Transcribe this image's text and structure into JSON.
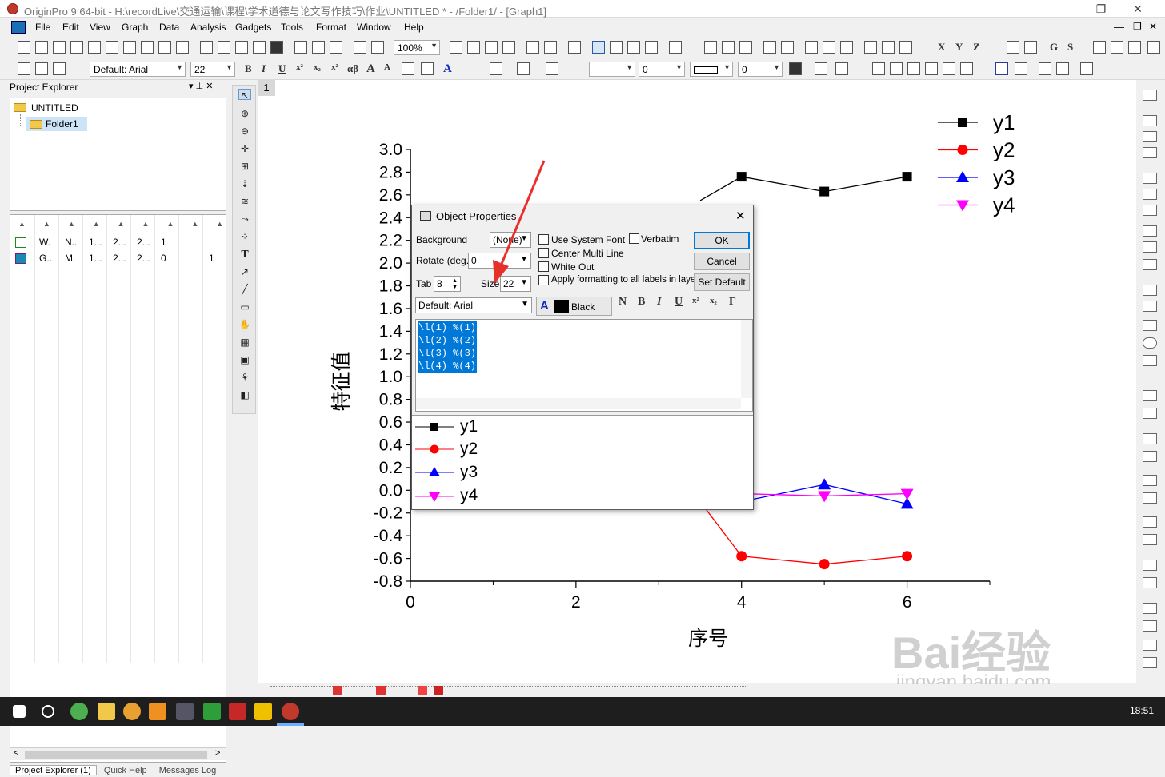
{
  "window": {
    "title": "OriginPro 9 64-bit - H:\\recordLive\\交通运输\\课程\\学术道德与论文写作技巧\\作业\\UNTITLED * - /Folder1/ - [Graph1]",
    "minimize": "—",
    "restore": "❐",
    "close": "✕"
  },
  "menu": {
    "file": "File",
    "edit": "Edit",
    "view": "View",
    "graph": "Graph",
    "data": "Data",
    "analysis": "Analysis",
    "gadgets": "Gadgets",
    "tools": "Tools",
    "format": "Format",
    "window": "Window",
    "help": "Help"
  },
  "toolbar": {
    "zoom": "100%",
    "font": "Default: Arial",
    "font_size": "22",
    "bold": "B",
    "italic": "I",
    "underline": "U",
    "superscript": "x²",
    "subscript": "x₂",
    "greek": "αβ",
    "font_larger": "A",
    "font_smaller": "A",
    "line_width": "0",
    "pattern": "0",
    "xyz": [
      "X",
      "Y",
      "Z"
    ],
    "gs": [
      "G",
      "S"
    ]
  },
  "project_explorer": {
    "title": "Project Explorer",
    "pin": "▾ ⊥ ✕",
    "root": "UNTITLED",
    "folder": "Folder1",
    "rows": [
      [
        "W.",
        "N..",
        "1...",
        "2...",
        "2...",
        "1",
        ""
      ],
      [
        "G..",
        "M.",
        "1...",
        "2...",
        "2...",
        "0",
        "1"
      ]
    ],
    "tabs": [
      "Project Explorer (1)",
      "Quick Help",
      "Messages Log"
    ]
  },
  "graph": {
    "tab": "1",
    "watermark_1": "Bai经验",
    "watermark_2": "jingyan.baidu.com"
  },
  "dialog": {
    "title": "Object Properties",
    "close": "✕",
    "background_label": "Background",
    "background_value": "(None)",
    "rotate_label": "Rotate (deg.)",
    "rotate_value": "0",
    "tab_label": "Tab",
    "tab_value": "8",
    "size_label": "Size",
    "size_value": "22",
    "font_value": "Default: Arial",
    "color_value": "Black",
    "use_system_font": "Use System Font",
    "verbatim": "Verbatim",
    "center_multi_line": "Center Multi Line",
    "white_out": "White Out",
    "apply_all": "Apply formatting to all labels in layer",
    "ok": "OK",
    "cancel": "Cancel",
    "set_default": "Set Default",
    "fmt": {
      "normal": "N",
      "bold": "B",
      "italic": "I",
      "underline": "U",
      "sup": "x²",
      "sub": "x₂",
      "greek": "Γ"
    },
    "text_lines": [
      "\\l(1) %(1)",
      "\\l(2) %(2)",
      "\\l(3) %(3)",
      "\\l(4) %(4)"
    ],
    "preview": [
      "y1",
      "y2",
      "y3",
      "y4"
    ]
  },
  "taskbar": {
    "time": "18:51"
  },
  "chart_data": {
    "type": "line",
    "xlabel": "序号",
    "ylabel": "特征值",
    "xlim": [
      0,
      7
    ],
    "ylim": [
      -0.8,
      3.0
    ],
    "xticks": [
      "0",
      "2",
      "4",
      "6"
    ],
    "yticks": [
      "-0.8",
      "-0.6",
      "-0.4",
      "-0.2",
      "0.0",
      "0.2",
      "0.4",
      "0.6",
      "0.8",
      "1.0",
      "1.2",
      "1.4",
      "1.6",
      "1.8",
      "2.0",
      "2.2",
      "2.4",
      "2.6",
      "2.8",
      "3.0"
    ],
    "legend_position": "top-right",
    "series": [
      {
        "name": "y1",
        "color": "#000000",
        "marker": "square",
        "x": [
          3.5,
          4,
          5,
          6
        ],
        "values": [
          2.55,
          2.76,
          2.63,
          2.76
        ]
      },
      {
        "name": "y2",
        "color": "#ff0000",
        "marker": "circle",
        "x": [
          3.5,
          4,
          5,
          6
        ],
        "values": [
          -0.1,
          -0.58,
          -0.65,
          -0.58
        ]
      },
      {
        "name": "y3",
        "color": "#0000ff",
        "marker": "triangle-up",
        "x": [
          4,
          5,
          6
        ],
        "values": [
          -0.1,
          0.05,
          -0.12
        ]
      },
      {
        "name": "y4",
        "color": "#ff00ff",
        "marker": "triangle-down",
        "x": [
          4,
          5,
          6
        ],
        "values": [
          -0.03,
          -0.05,
          -0.03
        ]
      }
    ]
  }
}
